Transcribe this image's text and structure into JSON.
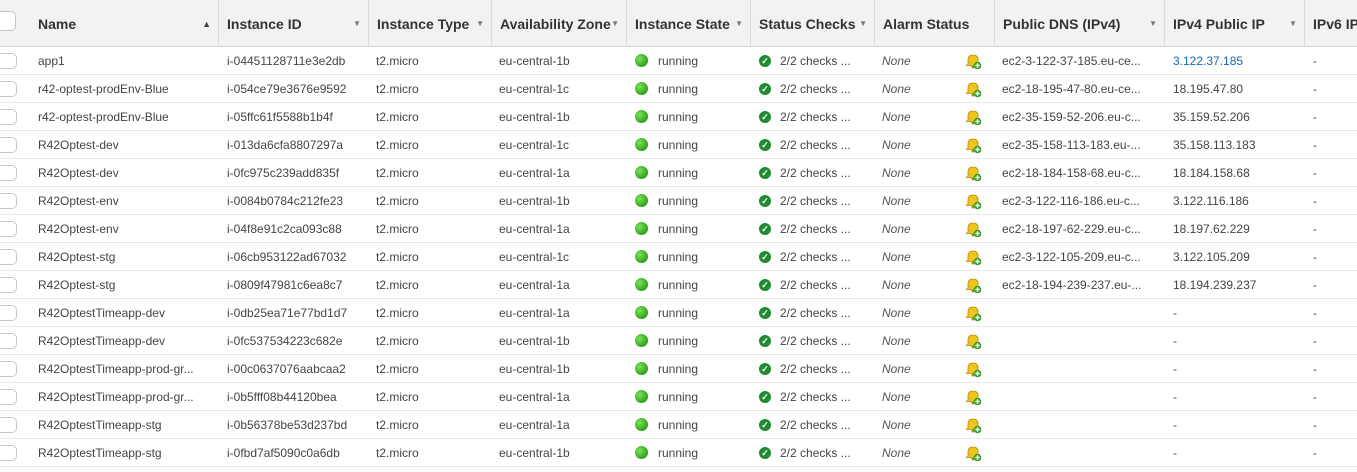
{
  "header": {
    "columns": [
      {
        "label": "Name",
        "sorted": true
      },
      {
        "label": "Instance ID"
      },
      {
        "label": "Instance Type"
      },
      {
        "label": "Availability Zone"
      },
      {
        "label": "Instance State"
      },
      {
        "label": "Status Checks"
      },
      {
        "label": "Alarm Status"
      },
      {
        "label": "Public DNS (IPv4)"
      },
      {
        "label": "IPv4 Public IP"
      },
      {
        "label": "IPv6 IP"
      }
    ]
  },
  "colors": {
    "running": "#2ea31b",
    "link": "#1a69b5",
    "ok": "#1f8b2f"
  },
  "rows": [
    {
      "name": "app1",
      "id": "i-04451128711e3e2db",
      "type": "t2.micro",
      "az": "eu-central-1b",
      "state": "running",
      "checks": "2/2 checks ...",
      "alarm": "None",
      "dns": "ec2-3-122-37-185.eu-ce...",
      "ip": "3.122.37.185",
      "ip_link": true,
      "ipv6": "-"
    },
    {
      "name": "r42-optest-prodEnv-Blue",
      "id": "i-054ce79e3676e9592",
      "type": "t2.micro",
      "az": "eu-central-1c",
      "state": "running",
      "checks": "2/2 checks ...",
      "alarm": "None",
      "dns": "ec2-18-195-47-80.eu-ce...",
      "ip": "18.195.47.80",
      "ipv6": "-"
    },
    {
      "name": "r42-optest-prodEnv-Blue",
      "id": "i-05ffc61f5588b1b4f",
      "type": "t2.micro",
      "az": "eu-central-1b",
      "state": "running",
      "checks": "2/2 checks ...",
      "alarm": "None",
      "dns": "ec2-35-159-52-206.eu-c...",
      "ip": "35.159.52.206",
      "ipv6": "-"
    },
    {
      "name": "R42Optest-dev",
      "id": "i-013da6cfa8807297a",
      "type": "t2.micro",
      "az": "eu-central-1c",
      "state": "running",
      "checks": "2/2 checks ...",
      "alarm": "None",
      "dns": "ec2-35-158-113-183.eu-...",
      "ip": "35.158.113.183",
      "ipv6": "-"
    },
    {
      "name": "R42Optest-dev",
      "id": "i-0fc975c239add835f",
      "type": "t2.micro",
      "az": "eu-central-1a",
      "state": "running",
      "checks": "2/2 checks ...",
      "alarm": "None",
      "dns": "ec2-18-184-158-68.eu-c...",
      "ip": "18.184.158.68",
      "ipv6": "-"
    },
    {
      "name": "R42Optest-env",
      "id": "i-0084b0784c212fe23",
      "type": "t2.micro",
      "az": "eu-central-1b",
      "state": "running",
      "checks": "2/2 checks ...",
      "alarm": "None",
      "dns": "ec2-3-122-116-186.eu-c...",
      "ip": "3.122.116.186",
      "ipv6": "-"
    },
    {
      "name": "R42Optest-env",
      "id": "i-04f8e91c2ca093c88",
      "type": "t2.micro",
      "az": "eu-central-1a",
      "state": "running",
      "checks": "2/2 checks ...",
      "alarm": "None",
      "dns": "ec2-18-197-62-229.eu-c...",
      "ip": "18.197.62.229",
      "ipv6": "-"
    },
    {
      "name": "R42Optest-stg",
      "id": "i-06cb953122ad67032",
      "type": "t2.micro",
      "az": "eu-central-1c",
      "state": "running",
      "checks": "2/2 checks ...",
      "alarm": "None",
      "dns": "ec2-3-122-105-209.eu-c...",
      "ip": "3.122.105.209",
      "ipv6": "-"
    },
    {
      "name": "R42Optest-stg",
      "id": "i-0809f47981c6ea8c7",
      "type": "t2.micro",
      "az": "eu-central-1a",
      "state": "running",
      "checks": "2/2 checks ...",
      "alarm": "None",
      "dns": "ec2-18-194-239-237.eu-...",
      "ip": "18.194.239.237",
      "ipv6": "-"
    },
    {
      "name": "R42OptestTimeapp-dev",
      "id": "i-0db25ea71e77bd1d7",
      "type": "t2.micro",
      "az": "eu-central-1a",
      "state": "running",
      "checks": "2/2 checks ...",
      "alarm": "None",
      "dns": "",
      "ip": "-",
      "ipv6": "-"
    },
    {
      "name": "R42OptestTimeapp-dev",
      "id": "i-0fc537534223c682e",
      "type": "t2.micro",
      "az": "eu-central-1b",
      "state": "running",
      "checks": "2/2 checks ...",
      "alarm": "None",
      "dns": "",
      "ip": "-",
      "ipv6": "-"
    },
    {
      "name": "R42OptestTimeapp-prod-gr...",
      "id": "i-00c0637076aabcaa2",
      "type": "t2.micro",
      "az": "eu-central-1b",
      "state": "running",
      "checks": "2/2 checks ...",
      "alarm": "None",
      "dns": "",
      "ip": "-",
      "ipv6": "-"
    },
    {
      "name": "R42OptestTimeapp-prod-gr...",
      "id": "i-0b5fff08b44120bea",
      "type": "t2.micro",
      "az": "eu-central-1a",
      "state": "running",
      "checks": "2/2 checks ...",
      "alarm": "None",
      "dns": "",
      "ip": "-",
      "ipv6": "-"
    },
    {
      "name": "R42OptestTimeapp-stg",
      "id": "i-0b56378be53d237bd",
      "type": "t2.micro",
      "az": "eu-central-1a",
      "state": "running",
      "checks": "2/2 checks ...",
      "alarm": "None",
      "dns": "",
      "ip": "-",
      "ipv6": "-"
    },
    {
      "name": "R42OptestTimeapp-stg",
      "id": "i-0fbd7af5090c0a6db",
      "type": "t2.micro",
      "az": "eu-central-1b",
      "state": "running",
      "checks": "2/2 checks ...",
      "alarm": "None",
      "dns": "",
      "ip": "-",
      "ipv6": "-"
    }
  ]
}
